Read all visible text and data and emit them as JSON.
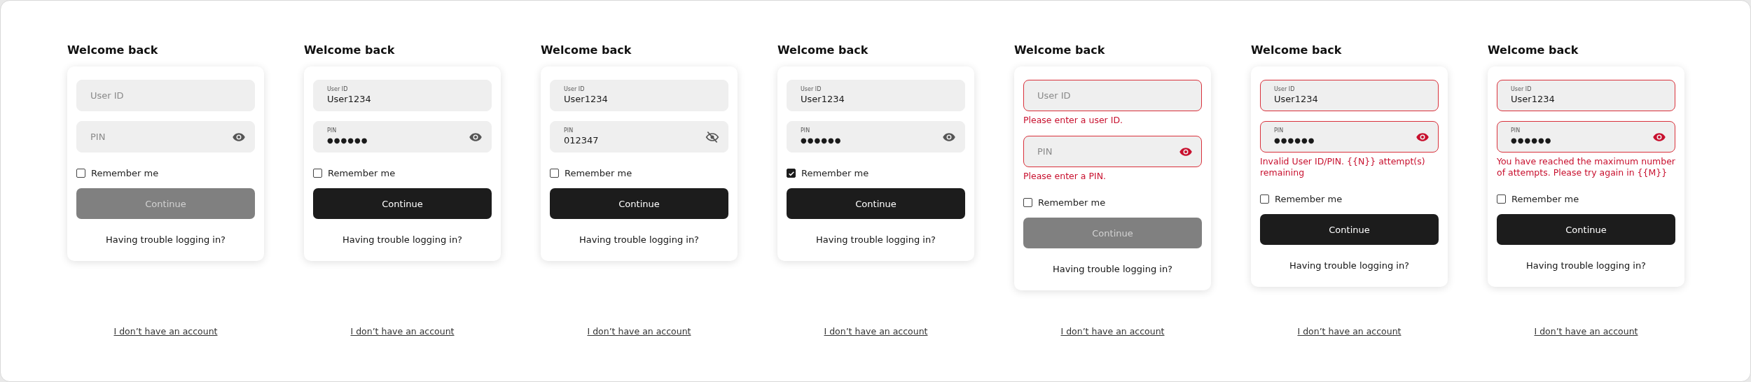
{
  "screens": [
    {
      "title": "Welcome back",
      "user_id": {
        "label": "User ID",
        "error": false
      },
      "pin": {
        "label": "PIN",
        "revealed": false,
        "error": false
      },
      "remember": {
        "label": "Remember me",
        "checked": false
      },
      "continue": {
        "label": "Continue",
        "disabled": true
      },
      "trouble_link": "Having trouble logging in?",
      "account_link": "I don’t have an account"
    },
    {
      "title": "Welcome back",
      "user_id": {
        "label": "User ID",
        "value": "User1234",
        "error": false
      },
      "pin": {
        "label": "PIN",
        "value": "●●●●●●",
        "revealed": false,
        "error": false
      },
      "remember": {
        "label": "Remember me",
        "checked": false
      },
      "continue": {
        "label": "Continue",
        "disabled": false
      },
      "trouble_link": "Having trouble logging in?",
      "account_link": "I don’t have an account"
    },
    {
      "title": "Welcome back",
      "user_id": {
        "label": "User ID",
        "value": "User1234",
        "error": false
      },
      "pin": {
        "label": "PIN",
        "value": "012347",
        "revealed": true,
        "error": false
      },
      "remember": {
        "label": "Remember me",
        "checked": false
      },
      "continue": {
        "label": "Continue",
        "disabled": false
      },
      "trouble_link": "Having trouble logging in?",
      "account_link": "I don’t have an account"
    },
    {
      "title": "Welcome back",
      "user_id": {
        "label": "User ID",
        "value": "User1234",
        "error": false
      },
      "pin": {
        "label": "PIN",
        "value": "●●●●●●",
        "revealed": false,
        "error": false
      },
      "remember": {
        "label": "Remember me",
        "checked": true
      },
      "continue": {
        "label": "Continue",
        "disabled": false
      },
      "trouble_link": "Having trouble logging in?",
      "account_link": "I don’t have an account"
    },
    {
      "title": "Welcome back",
      "user_id": {
        "label": "User ID",
        "error": true,
        "error_text": "Please enter a user ID."
      },
      "pin": {
        "label": "PIN",
        "revealed": false,
        "error": true,
        "error_text": "Please enter a PIN."
      },
      "remember": {
        "label": "Remember me",
        "checked": false
      },
      "continue": {
        "label": "Continue",
        "disabled": true
      },
      "trouble_link": "Having trouble logging in?",
      "account_link": "I don’t have an account"
    },
    {
      "title": "Welcome back",
      "user_id": {
        "label": "User ID",
        "value": "User1234",
        "error": true
      },
      "pin": {
        "label": "PIN",
        "value": "●●●●●●",
        "revealed": false,
        "error": true,
        "error_text": "Invalid User ID/PIN. {{N}} attempt(s) remaining"
      },
      "remember": {
        "label": "Remember me",
        "checked": false
      },
      "continue": {
        "label": "Continue",
        "disabled": false
      },
      "trouble_link": "Having trouble logging in?",
      "account_link": "I don’t have an account"
    },
    {
      "title": "Welcome back",
      "user_id": {
        "label": "User ID",
        "value": "User1234",
        "error": true
      },
      "pin": {
        "label": "PIN",
        "value": "●●●●●●",
        "revealed": false,
        "error": true,
        "error_text": "You have reached the maximum number of attempts. Please try again in {{M}}"
      },
      "remember": {
        "label": "Remember me",
        "checked": false
      },
      "continue": {
        "label": "Continue",
        "disabled": false
      },
      "trouble_link": "Having trouble logging in?",
      "account_link": "I don’t have an account"
    }
  ]
}
